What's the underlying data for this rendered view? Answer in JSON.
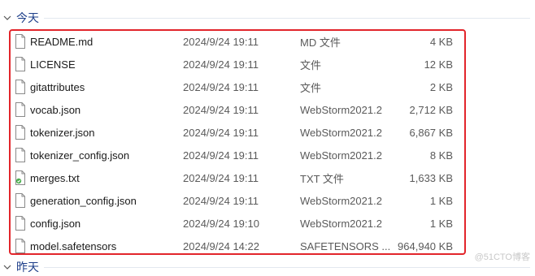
{
  "groups": {
    "today": "今天",
    "yesterday": "昨天"
  },
  "files": [
    {
      "name": "README.md",
      "date": "2024/9/24 19:11",
      "type": "MD 文件",
      "size": "4 KB",
      "icon": "generic-file-icon"
    },
    {
      "name": "LICENSE",
      "date": "2024/9/24 19:11",
      "type": "文件",
      "size": "12 KB",
      "icon": "generic-file-icon"
    },
    {
      "name": "gitattributes",
      "date": "2024/9/24 19:11",
      "type": "文件",
      "size": "2 KB",
      "icon": "generic-file-icon"
    },
    {
      "name": "vocab.json",
      "date": "2024/9/24 19:11",
      "type": "WebStorm2021.2",
      "size": "2,712 KB",
      "icon": "generic-file-icon"
    },
    {
      "name": "tokenizer.json",
      "date": "2024/9/24 19:11",
      "type": "WebStorm2021.2",
      "size": "6,867 KB",
      "icon": "generic-file-icon"
    },
    {
      "name": "tokenizer_config.json",
      "date": "2024/9/24 19:11",
      "type": "WebStorm2021.2",
      "size": "8 KB",
      "icon": "generic-file-icon"
    },
    {
      "name": "merges.txt",
      "date": "2024/9/24 19:11",
      "type": "TXT 文件",
      "size": "1,633 KB",
      "icon": "text-file-icon"
    },
    {
      "name": "generation_config.json",
      "date": "2024/9/24 19:11",
      "type": "WebStorm2021.2",
      "size": "1 KB",
      "icon": "generic-file-icon"
    },
    {
      "name": "config.json",
      "date": "2024/9/24 19:10",
      "type": "WebStorm2021.2",
      "size": "1 KB",
      "icon": "generic-file-icon"
    },
    {
      "name": "model.safetensors",
      "date": "2024/9/24 14:22",
      "type": "SAFETENSORS ...",
      "size": "964,940 KB",
      "icon": "generic-file-icon"
    }
  ],
  "watermark": "@51CTO博客",
  "colors": {
    "highlight": "#e2252b",
    "group_label": "#1e3f8a"
  }
}
